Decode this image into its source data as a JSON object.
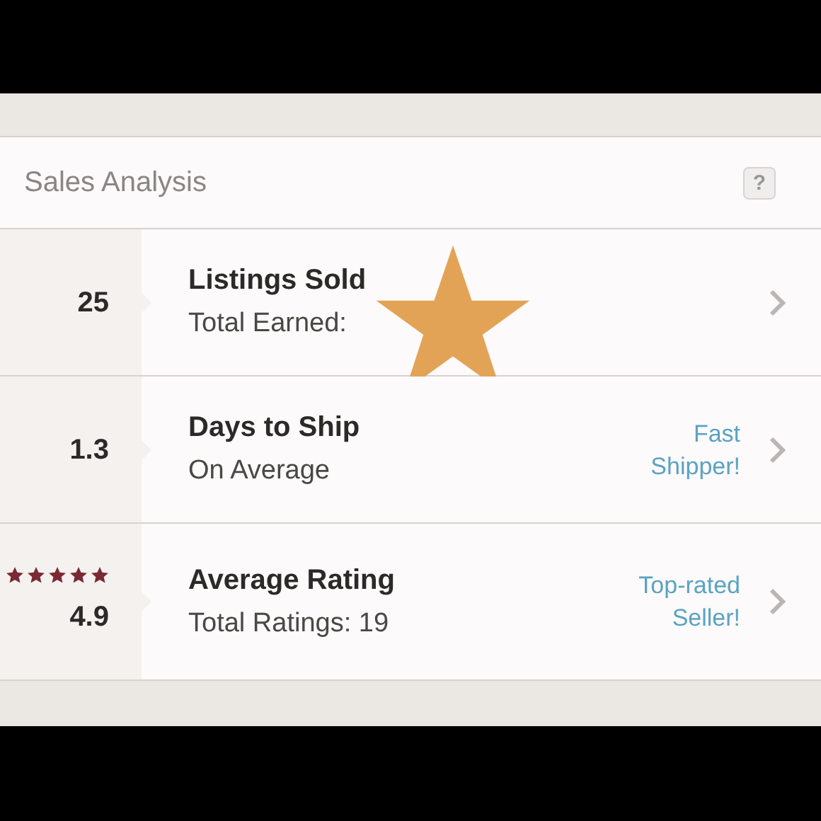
{
  "header": {
    "title": "Sales Analysis",
    "help": "?"
  },
  "rows": [
    {
      "value": "25",
      "title": "Listings Sold",
      "subtitle": "Total Earned:",
      "overlay_star": true
    },
    {
      "value": "1.3",
      "title": "Days to Ship",
      "subtitle": "On Average",
      "badge": "Fast\nShipper!"
    },
    {
      "value": "4.9",
      "stars": 5,
      "title": "Average Rating",
      "subtitle": "Total Ratings: 19",
      "badge": "Top-rated\nSeller!"
    }
  ]
}
